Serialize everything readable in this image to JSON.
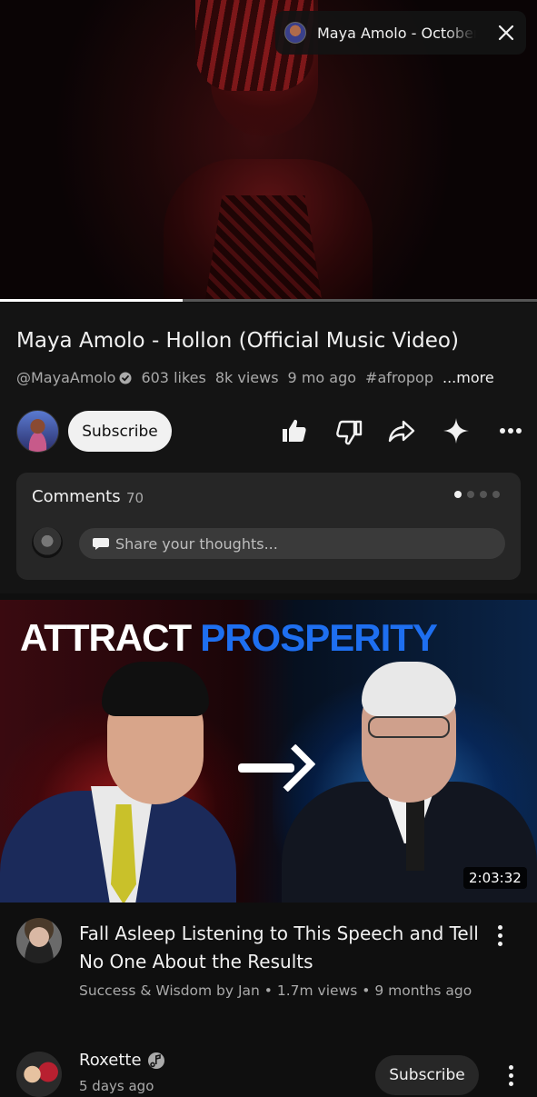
{
  "player": {
    "pip_title": "Maya Amolo - October",
    "progress_fraction": 0.34
  },
  "video": {
    "title": "Maya Amolo - Hollon (Official Music Video)",
    "channel_handle": "@MayaAmolo",
    "likes": "603 likes",
    "views": "8k views",
    "age": "9 mo ago",
    "hashtag": "#afropop",
    "more_label": "...more",
    "subscribe_label": "Subscribe"
  },
  "actions": {
    "icons": [
      "thumbs-up-icon",
      "thumbs-down-icon",
      "share-icon",
      "sparkle-icon",
      "more-icon"
    ]
  },
  "comments": {
    "label": "Comments",
    "count": "70",
    "placeholder": "Share your thoughts...",
    "pages": 4,
    "active_page": 0
  },
  "recommended": {
    "thumbnail_heading_1": "ATTRACT",
    "thumbnail_heading_2": "PROSPERITY",
    "duration": "2:03:32",
    "title": "Fall Asleep Listening to This Speech and Tell No One About the Results",
    "meta": "Success & Wisdom by Jan • 1.7m views • 9 months ago"
  },
  "next_item": {
    "channel_name": "Roxette",
    "subtitle": "5 days ago",
    "subscribe_label": "Subscribe"
  },
  "colors": {
    "background": "#0f0f0f",
    "panel": "#141414",
    "card": "#262626",
    "accent_blue": "#1e6ff0"
  }
}
